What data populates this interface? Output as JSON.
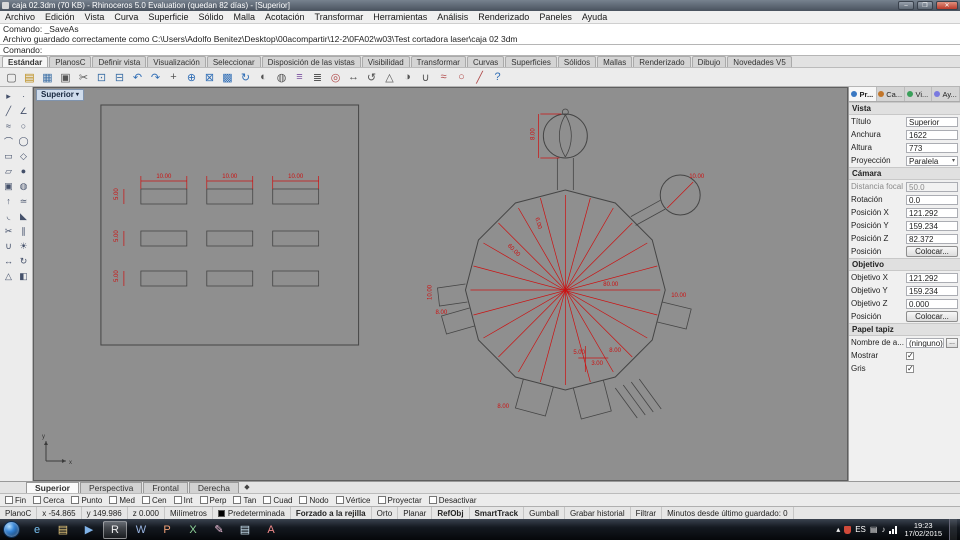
{
  "window": {
    "title": "caja 02.3dm (70 KB) - Rhinoceros 5.0 Evaluation (quedan 82 días) - [Superior]",
    "minimize": "–",
    "maximize": "❐",
    "close": "✕"
  },
  "menu": {
    "items": [
      "Archivo",
      "Edición",
      "Vista",
      "Curva",
      "Superficie",
      "Sólido",
      "Malla",
      "Acotación",
      "Transformar",
      "Herramientas",
      "Análisis",
      "Renderizado",
      "Paneles",
      "Ayuda"
    ]
  },
  "command": {
    "line1": "Comando: _SaveAs",
    "line2": "Archivo guardado correctamente como C:\\Users\\Adolfo Benitez\\Desktop\\00acompartir\\12-2\\0FA02\\w03\\Test cortadora laser\\caja 02 3dm",
    "prompt": "Comando:"
  },
  "toolbar_tabs": {
    "items": [
      {
        "label": "Estándar",
        "active": true
      },
      {
        "label": "PlanosC"
      },
      {
        "label": "Definir vista"
      },
      {
        "label": "Visualización"
      },
      {
        "label": "Seleccionar"
      },
      {
        "label": "Disposición de las vistas"
      },
      {
        "label": "Visibilidad"
      },
      {
        "label": "Transformar"
      },
      {
        "label": "Curvas"
      },
      {
        "label": "Superficies"
      },
      {
        "label": "Sólidos"
      },
      {
        "label": "Mallas"
      },
      {
        "label": "Renderizado"
      },
      {
        "label": "Dibujo"
      },
      {
        "label": "Novedades V5"
      }
    ]
  },
  "toolbar_icons": {
    "items": [
      {
        "name": "new-file-icon",
        "glyph": "▢",
        "fg": "#555555"
      },
      {
        "name": "open-file-icon",
        "glyph": "▤",
        "fg": "#b8860b"
      },
      {
        "name": "save-icon",
        "glyph": "▦",
        "fg": "#3a6ea5"
      },
      {
        "name": "print-icon",
        "glyph": "▣",
        "fg": "#555555"
      },
      {
        "name": "cut-icon",
        "glyph": "✂",
        "fg": "#555555"
      },
      {
        "name": "copy-icon",
        "glyph": "⊡",
        "fg": "#3a6ea5"
      },
      {
        "name": "paste-icon",
        "glyph": "⊟",
        "fg": "#3a6ea5"
      },
      {
        "name": "undo-icon",
        "glyph": "↶",
        "fg": "#2f6db5"
      },
      {
        "name": "redo-icon",
        "glyph": "↷",
        "fg": "#2f6db5"
      },
      {
        "name": "pan-icon",
        "glyph": "+",
        "fg": "#555555"
      },
      {
        "name": "zoom-icon",
        "glyph": "⊕",
        "fg": "#2f6db5"
      },
      {
        "name": "zoom-window-icon",
        "glyph": "⊠",
        "fg": "#2f6db5"
      },
      {
        "name": "zoom-extents-icon",
        "glyph": "▩",
        "fg": "#2f6db5"
      },
      {
        "name": "rotate-view-icon",
        "glyph": "↻",
        "fg": "#2f6db5"
      },
      {
        "name": "shaded-view-icon",
        "glyph": "◐",
        "fg": "#555555"
      },
      {
        "name": "wireframe-view-icon",
        "glyph": "◍",
        "fg": "#555555"
      },
      {
        "name": "layers-icon",
        "glyph": "≡",
        "fg": "#7a4fa0"
      },
      {
        "name": "properties-icon",
        "glyph": "≣",
        "fg": "#555555"
      },
      {
        "name": "osnap-toggle-icon",
        "glyph": "◎",
        "fg": "#b04a4a"
      },
      {
        "name": "move-icon",
        "glyph": "↔",
        "fg": "#555555"
      },
      {
        "name": "rotate-icon",
        "glyph": "↺",
        "fg": "#555555"
      },
      {
        "name": "scale-icon",
        "glyph": "△",
        "fg": "#555555"
      },
      {
        "name": "mirror-icon",
        "glyph": "◑",
        "fg": "#555555"
      },
      {
        "name": "join-icon",
        "glyph": "∪",
        "fg": "#555555"
      },
      {
        "name": "curve-icon",
        "glyph": "≈",
        "fg": "#b04a4a"
      },
      {
        "name": "circle-icon",
        "glyph": "○",
        "fg": "#b04a4a"
      },
      {
        "name": "line-icon",
        "glyph": "╱",
        "fg": "#b04a4a"
      },
      {
        "name": "help-icon",
        "glyph": "?",
        "fg": "#2f6db5"
      }
    ]
  },
  "left_toolbar": {
    "items": [
      {
        "name": "select-icon",
        "glyph": "▸"
      },
      {
        "name": "select-points-icon",
        "glyph": "∙"
      },
      {
        "name": "line-tool-icon",
        "glyph": "╱"
      },
      {
        "name": "polyline-tool-icon",
        "glyph": "∠"
      },
      {
        "name": "curve-tool-icon",
        "glyph": "≈"
      },
      {
        "name": "circle-tool-icon",
        "glyph": "○"
      },
      {
        "name": "arc-tool-icon",
        "glyph": "⌒"
      },
      {
        "name": "ellipse-tool-icon",
        "glyph": "◯"
      },
      {
        "name": "rectangle-tool-icon",
        "glyph": "▭"
      },
      {
        "name": "polygon-tool-icon",
        "glyph": "◇"
      },
      {
        "name": "surface-tool-icon",
        "glyph": "▱"
      },
      {
        "name": "sphere-tool-icon",
        "glyph": "●"
      },
      {
        "name": "box-tool-icon",
        "glyph": "▣"
      },
      {
        "name": "cylinder-tool-icon",
        "glyph": "◍"
      },
      {
        "name": "extrude-tool-icon",
        "glyph": "↑"
      },
      {
        "name": "loft-tool-icon",
        "glyph": "≃"
      },
      {
        "name": "fillet-tool-icon",
        "glyph": "◟"
      },
      {
        "name": "chamfer-tool-icon",
        "glyph": "◣"
      },
      {
        "name": "trim-tool-icon",
        "glyph": "✂"
      },
      {
        "name": "split-tool-icon",
        "glyph": "∥"
      },
      {
        "name": "join-tool-icon",
        "glyph": "∪"
      },
      {
        "name": "explode-tool-icon",
        "glyph": "☀"
      },
      {
        "name": "move-tool-icon",
        "glyph": "↔"
      },
      {
        "name": "rotate-tool-icon",
        "glyph": "↻"
      },
      {
        "name": "scale-tool-icon",
        "glyph": "△"
      },
      {
        "name": "mirror-tool-icon",
        "glyph": "◧"
      }
    ]
  },
  "viewport": {
    "label": "Superior",
    "dims": {
      "a1": "10.00",
      "a2": "10.00",
      "a3": "10.00",
      "r1": "5.00",
      "r2": "5.00",
      "r3": "5.00",
      "g1": "60.00",
      "g2": "80.00",
      "g3": "10.00",
      "g4": "8.00",
      "g5": "10.00",
      "g6": "5.00",
      "g7": "3.00",
      "g8": "8.00",
      "g9": "10.00",
      "g10": "8.00",
      "g11": "6.00",
      "g12": "8.00"
    },
    "axis": {
      "x": "x",
      "y": "y"
    }
  },
  "panel": {
    "tabs": {
      "t1": "Pr...",
      "t2": "Ca...",
      "t3": "Vi...",
      "t4": "Ay..."
    },
    "vista": {
      "title": "Vista",
      "titulo_label": "Título",
      "titulo_value": "Superior",
      "anchura_label": "Anchura",
      "anchura_value": "1622",
      "altura_label": "Altura",
      "altura_value": "773",
      "proyeccion_label": "Proyección",
      "proyeccion_value": "Paralela"
    },
    "camara": {
      "title": "Cámara",
      "focal_label": "Distancia focal",
      "focal_value": "50.0",
      "rotacion_label": "Rotación",
      "rotacion_value": "0.0",
      "posx_label": "Posición X",
      "posx_value": "121.292",
      "posy_label": "Posición Y",
      "posy_value": "159.234",
      "posz_label": "Posición Z",
      "posz_value": "82.372",
      "pos_label": "Posición",
      "pos_button": "Colocar..."
    },
    "objetivo": {
      "title": "Objetivo",
      "objx_label": "Objetivo X",
      "objx_value": "121.292",
      "objy_label": "Objetivo Y",
      "objy_value": "159.234",
      "objz_label": "Objetivo Z",
      "objz_value": "0.000",
      "pos_label": "Posición",
      "pos_button": "Colocar..."
    },
    "papel": {
      "title": "Papel tapiz",
      "nombre_label": "Nombre de a...",
      "nombre_value": "(ninguno)",
      "browse": "...",
      "mostrar_label": "Mostrar",
      "mostrar_checked": true,
      "gris_label": "Gris",
      "gris_checked": true
    }
  },
  "viewport_tabs": {
    "t1": "Superior",
    "t2": "Perspectiva",
    "t3": "Frontal",
    "t4": "Derecha",
    "more": "◆"
  },
  "osnap": {
    "items": [
      "Fin",
      "Cerca",
      "Punto",
      "Med",
      "Cen",
      "Int",
      "Perp",
      "Tan",
      "Cuad",
      "Nodo",
      "Vértice",
      "Proyectar",
      "Desactivar"
    ]
  },
  "statusbar": {
    "planoc": "PlanoC",
    "x": "x -54.865",
    "y": "y 149.986",
    "z": "z 0.000",
    "units": "Milímetros",
    "layer": "Predeterminada",
    "grid": "Forzado a la rejilla",
    "ortho": "Orto",
    "planar": "Planar",
    "osnap": "RefObj",
    "smarttrack": "SmartTrack",
    "gumball": "Gumball",
    "history": "Grabar historial",
    "filter": "Filtrar",
    "saved": "Minutos desde último guardado: 0"
  },
  "taskbar": {
    "apps": [
      {
        "name": "ie-icon",
        "glyph": "e",
        "fg": "#79c2f2"
      },
      {
        "name": "explorer-icon",
        "glyph": "▤",
        "fg": "#f0d080"
      },
      {
        "name": "media-player-icon",
        "glyph": "▶",
        "fg": "#7fb2e8"
      },
      {
        "name": "rhino-icon",
        "glyph": "R",
        "fg": "#eeeeee",
        "active": true
      },
      {
        "name": "word-icon",
        "glyph": "W",
        "fg": "#9ab6e4"
      },
      {
        "name": "powerpoint-icon",
        "glyph": "P",
        "fg": "#f2a178"
      },
      {
        "name": "excel-icon",
        "glyph": "X",
        "fg": "#8fd49a"
      },
      {
        "name": "paint-icon",
        "glyph": "✎",
        "fg": "#f2c3dd"
      },
      {
        "name": "notepad-icon",
        "glyph": "▤",
        "fg": "#cfe8f7"
      },
      {
        "name": "acrobat-icon",
        "glyph": "A",
        "fg": "#f28a8a"
      }
    ],
    "tray": {
      "expand": "▴",
      "lang": "ES",
      "keyboard": "▤",
      "volume": "♪",
      "time": "19:23",
      "date": "17/02/2015"
    }
  }
}
